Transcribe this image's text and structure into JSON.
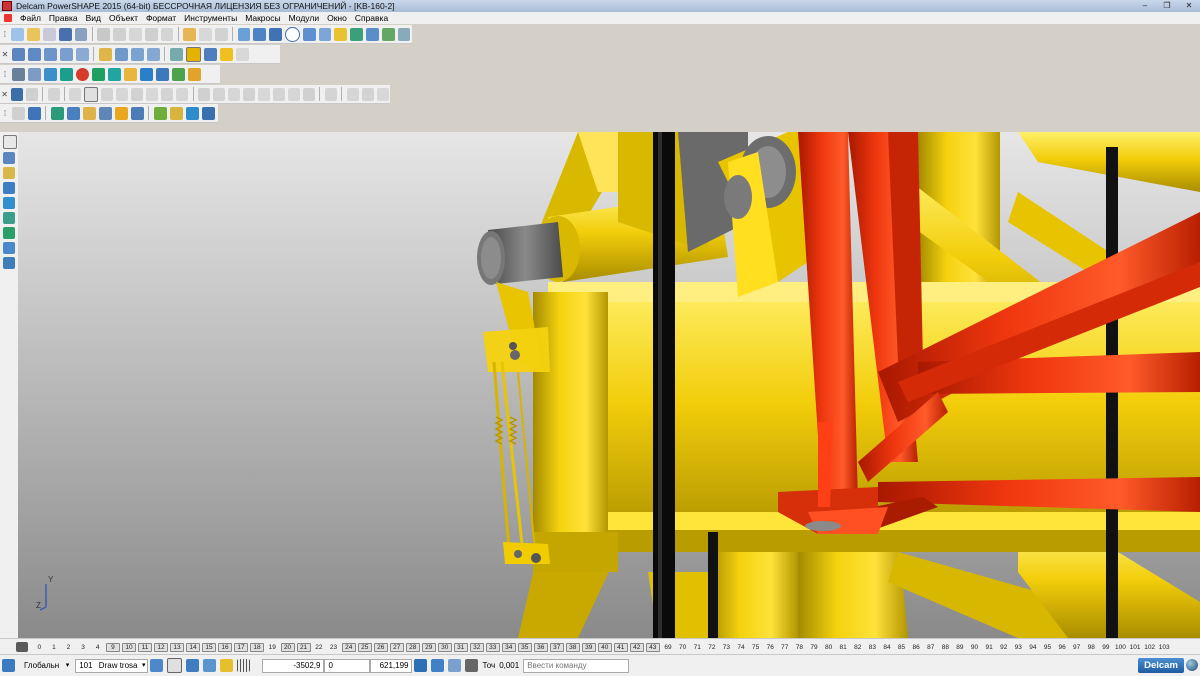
{
  "titlebar": {
    "title": "Delcam PowerSHAPE 2015 (64-bit) БЕССРОЧНАЯ ЛИЦЕНЗИЯ БЕЗ ОГРАНИЧЕНИЙ - [KB-160-2]",
    "minimize": "–",
    "restore": "❐",
    "close": "✕"
  },
  "menubar": {
    "items": [
      "Файл",
      "Правка",
      "Вид",
      "Объект",
      "Формат",
      "Инструменты",
      "Макросы",
      "Модули",
      "Окно",
      "Справка"
    ]
  },
  "levels": {
    "numbers": [
      "0",
      "1",
      "2",
      "3",
      "4",
      "9",
      "10",
      "11",
      "12",
      "13",
      "14",
      "15",
      "16",
      "17",
      "18",
      "19",
      "20",
      "21",
      "22",
      "23",
      "24",
      "25",
      "26",
      "27",
      "28",
      "29",
      "30",
      "31",
      "32",
      "33",
      "34",
      "35",
      "36",
      "37",
      "38",
      "39",
      "40",
      "41",
      "42",
      "43",
      "69",
      "70",
      "71",
      "72",
      "73",
      "74",
      "75",
      "76",
      "77",
      "78",
      "79",
      "80",
      "81",
      "82",
      "83",
      "84",
      "85",
      "86",
      "87",
      "88",
      "89",
      "90",
      "91",
      "92",
      "93",
      "94",
      "95",
      "96",
      "97",
      "98",
      "99",
      "100",
      "101",
      "102",
      "103"
    ],
    "active": [
      "9",
      "10",
      "11",
      "12",
      "13",
      "14",
      "15",
      "16",
      "17",
      "18",
      "20",
      "21",
      "24",
      "25",
      "26",
      "27",
      "28",
      "29",
      "30",
      "31",
      "32",
      "33",
      "34",
      "35",
      "36",
      "37",
      "38",
      "39",
      "40",
      "41",
      "42",
      "43"
    ]
  },
  "status": {
    "workplane": "Глобальн",
    "level_number": "101",
    "level_name": "Draw trosa",
    "coord_x": "-3502,9",
    "coord_y": "0",
    "coord_z": "621,199",
    "tolerance_label": "Точ",
    "tolerance_value": "0,001",
    "command_placeholder": "Ввести команду",
    "brand": "Delcam"
  },
  "axis": {
    "y_label": "Y",
    "z_label": "Z"
  },
  "colors": {
    "yellow": "#f2cd0a",
    "red": "#e8270b",
    "steel": "#6f6f6f"
  }
}
